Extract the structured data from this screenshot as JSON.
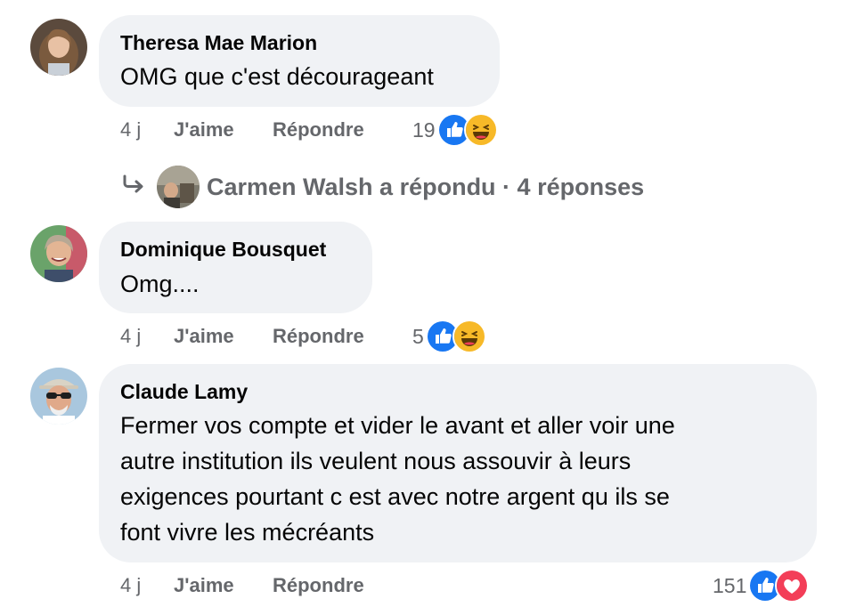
{
  "comments": [
    {
      "author": "Theresa Mae Marion",
      "text_lines": [
        "OMG que c'est décourageant"
      ],
      "time": "4 j",
      "like_label": "J'aime",
      "reply_label": "Répondre",
      "reaction_count": "19",
      "reactions": [
        "like-icon",
        "haha-icon"
      ]
    },
    {
      "author": "Dominique Bousquet",
      "text_lines": [
        "Omg...."
      ],
      "time": "4 j",
      "like_label": "J'aime",
      "reply_label": "Répondre",
      "reaction_count": "5",
      "reactions": [
        "like-icon",
        "haha-icon"
      ]
    },
    {
      "author": "Claude Lamy",
      "text_lines": [
        "Fermer vos compte et vider le avant et aller voir une",
        "autre institution ils veulent nous assouvir à leurs",
        "exigences pourtant c est avec notre argent qu ils se",
        "font vivre les mécréants"
      ],
      "time": "4 j",
      "like_label": "J'aime",
      "reply_label": "Répondre",
      "reaction_count": "151",
      "reactions": [
        "like-icon",
        "love-icon"
      ]
    }
  ],
  "replies_summary": {
    "arrow_icon": "reply-arrow-icon",
    "text": "Carmen Walsh a répondu · 4 réponses"
  },
  "colors": {
    "bubble": "#f0f2f5",
    "meta_text": "#65676b",
    "like_blue": "#1877f2",
    "haha_yellow": "#f7b928",
    "love_red": "#f33e58"
  }
}
